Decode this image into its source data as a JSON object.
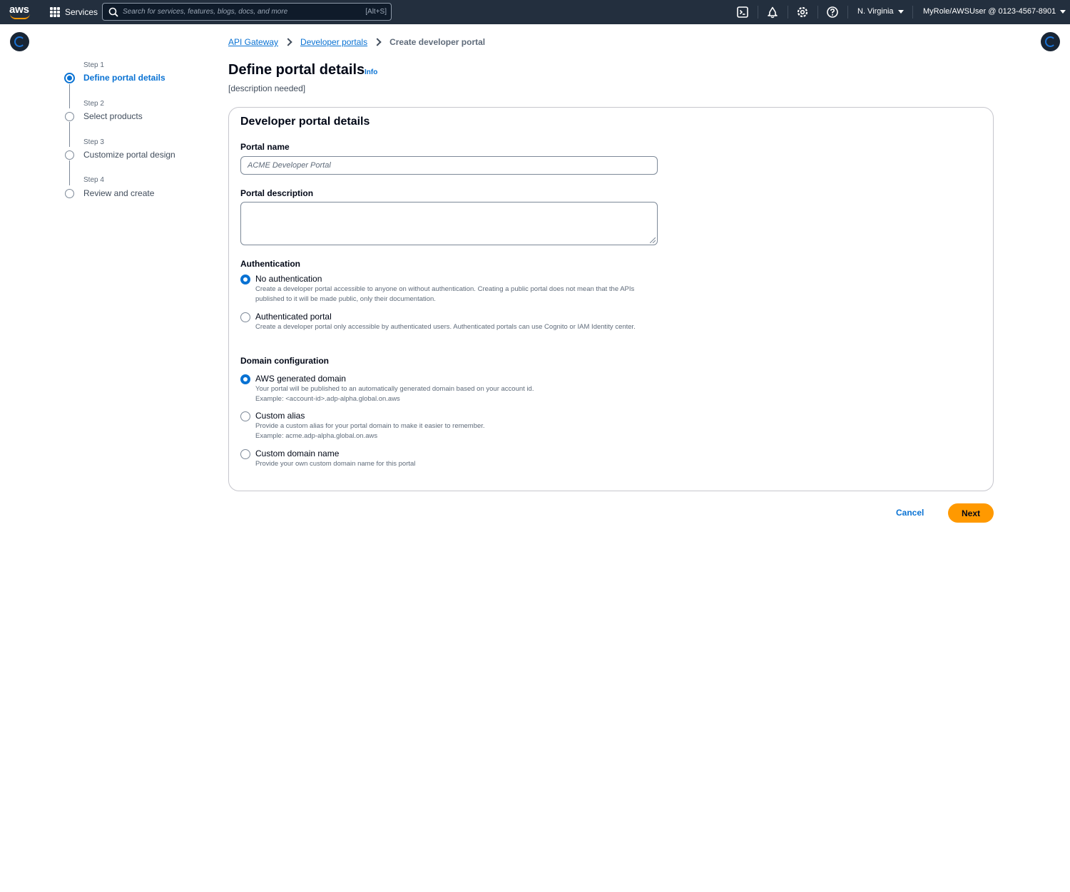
{
  "brand": {
    "logo_text": "aws",
    "accent": "#ff9900",
    "link_color": "#0972d3",
    "nav_bg": "#232f3e"
  },
  "topnav": {
    "services_label": "Services",
    "search_placeholder": "Search for services, features, blogs, docs, and more",
    "search_shortcut": "[Alt+S]",
    "icons": [
      "cloudshell-icon",
      "notifications-icon",
      "settings-icon",
      "help-icon"
    ],
    "region": "N. Virginia",
    "account": "MyRole/AWSUser @ 0123-4567-8901"
  },
  "steps": [
    {
      "number": "Step 1",
      "label": "Define portal details",
      "active": true
    },
    {
      "number": "Step 2",
      "label": "Select products",
      "active": false
    },
    {
      "number": "Step 3",
      "label": "Customize portal design",
      "active": false
    },
    {
      "number": "Step 4",
      "label": "Review and create",
      "active": false
    }
  ],
  "breadcrumb": {
    "items": [
      "API Gateway",
      "Developer portals"
    ],
    "current": "Create developer portal"
  },
  "page": {
    "title": "Define portal details",
    "info": "Info",
    "description": "[description needed]"
  },
  "form": {
    "heading": "Developer portal details",
    "portal_name_label": "Portal name",
    "portal_name_placeholder": "ACME Developer Portal",
    "portal_description_label": "Portal description",
    "authentication": {
      "label": "Authentication",
      "options": [
        {
          "title": "No authentication",
          "description": "Create a developer portal accessible to anyone on without authentication. Creating a public portal does not mean that the APIs published to it will be made public, only their documentation.",
          "checked": true
        },
        {
          "title": "Authenticated portal",
          "description": "Create a developer portal only accessible by authenticated users. Authenticated portals can use Cognito or IAM Identity center.",
          "checked": false
        }
      ]
    },
    "domain": {
      "label": "Domain configuration",
      "options": [
        {
          "title": "AWS generated domain",
          "description": "Your portal will be published to an automatically generated domain based on your account id.",
          "example": "Example: <account-id>.adp-alpha.global.on.aws",
          "checked": true
        },
        {
          "title": "Custom alias",
          "description": "Provide a custom alias for your portal domain to make it easier to remember.",
          "example": "Example: acme.adp-alpha.global.on.aws",
          "checked": false
        },
        {
          "title": "Custom domain name",
          "description": "Provide your own custom domain name for this portal",
          "example": "",
          "checked": false
        }
      ]
    }
  },
  "actions": {
    "cancel": "Cancel",
    "next": "Next"
  }
}
